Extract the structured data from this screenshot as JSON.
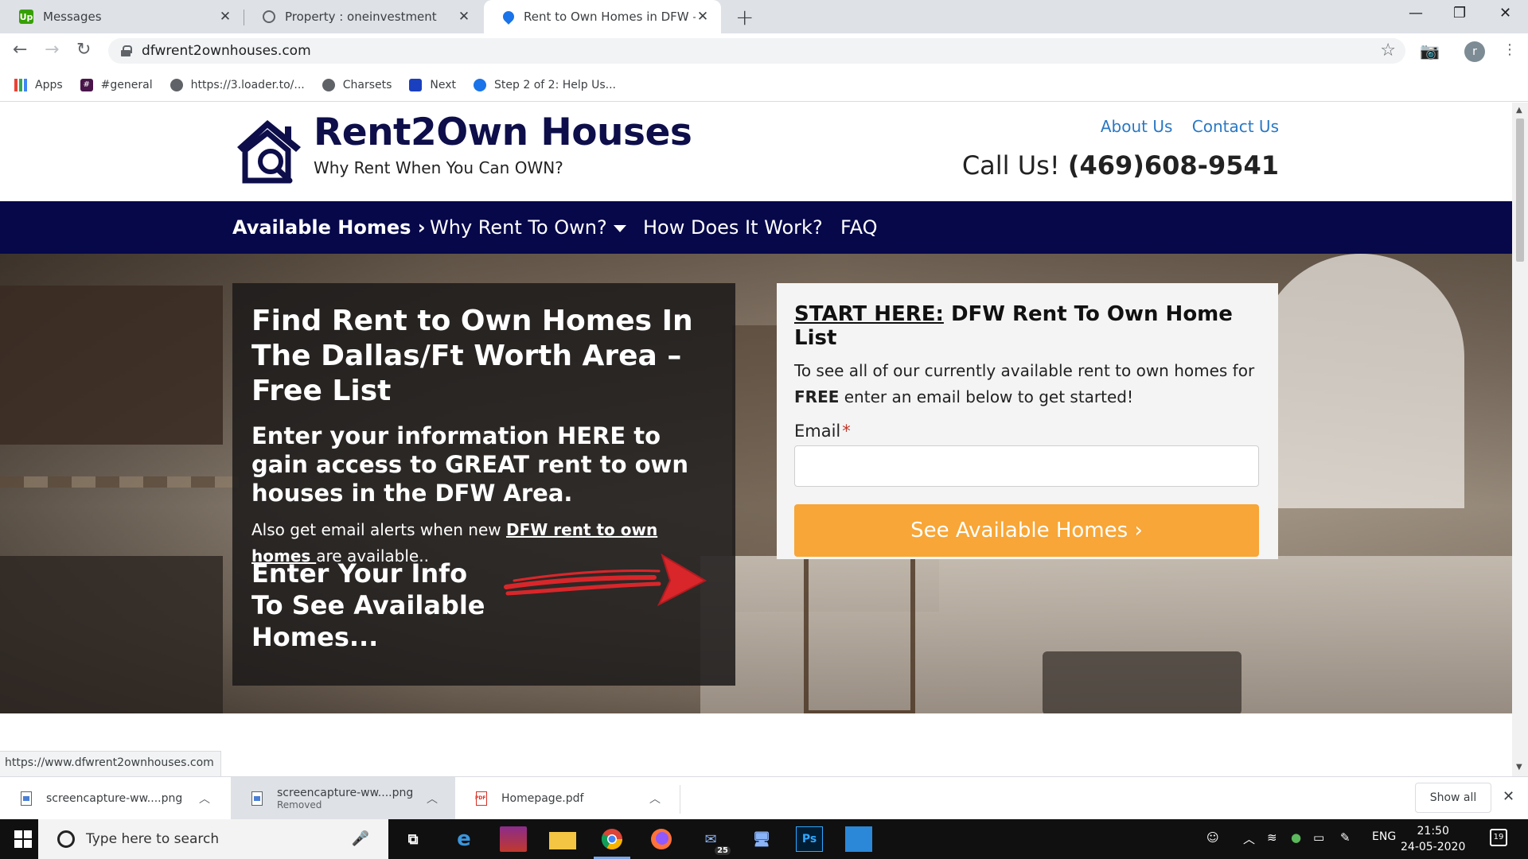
{
  "browser": {
    "tabs": [
      {
        "title": "Messages",
        "favicon": "upwork-icon"
      },
      {
        "title": "Property : oneinvestment",
        "favicon": "globe-icon"
      },
      {
        "title": "Rent to Own Homes in DFW – Re",
        "favicon": "location-icon"
      }
    ],
    "url": "dfwrent2ownhouses.com",
    "profile_initial": "r",
    "bookmarks": [
      {
        "label": "Apps",
        "icon": "apps-grid-icon"
      },
      {
        "label": "#general",
        "icon": "slack-icon"
      },
      {
        "label": "https://3.loader.to/...",
        "icon": "globe-icon"
      },
      {
        "label": "Charsets",
        "icon": "globe-icon"
      },
      {
        "label": "Next",
        "icon": "app-icon"
      },
      {
        "label": "Step 2 of 2: Help Us...",
        "icon": "location-icon"
      }
    ],
    "status_url": "https://www.dfwrent2ownhouses.com"
  },
  "site": {
    "brand": "Rent2Own Houses",
    "tagline": "Why Rent When You Can OWN?",
    "links": {
      "about": "About Us",
      "contact": "Contact Us"
    },
    "call_label": "Call Us!",
    "phone": "(469)608-9541",
    "nav": {
      "available": "Available Homes ›",
      "why": "Why Rent To Own?",
      "how": "How Does It Work?",
      "faq": "FAQ"
    },
    "hero": {
      "heading": "Find Rent to Own Homes In The Dallas/Ft Worth Area – Free List",
      "subheading": "Enter your information HERE to gain access to GREAT rent to own houses in the DFW Area.",
      "alert_text_pre": "Also get email alerts when new ",
      "alert_link": "DFW rent to own homes ",
      "alert_text_post": "are available..",
      "cta_prompt": "Enter Your Info To See Available Homes..."
    },
    "form": {
      "title_underlined": "START HERE:",
      "title_rest": " DFW Rent To Own Home List",
      "desc_pre": "To see all of our currently available rent to own homes for ",
      "desc_bold": "FREE",
      "desc_post": " enter an email below to get started!",
      "email_label": "Email",
      "required_mark": "*",
      "email_value": "",
      "submit": "See Available Homes ›",
      "button_color": "#f7a637"
    }
  },
  "downloads": {
    "items": [
      {
        "name": "screencapture-ww....png",
        "sub": ""
      },
      {
        "name": "screencapture-ww....png",
        "sub": "Removed"
      },
      {
        "name": "Homepage.pdf",
        "sub": ""
      }
    ],
    "show_all": "Show all"
  },
  "taskbar": {
    "search_placeholder": "Type here to search",
    "mail_badge": "25",
    "lang": "ENG",
    "time": "21:50",
    "date": "24-05-2020",
    "notifications": "19"
  }
}
